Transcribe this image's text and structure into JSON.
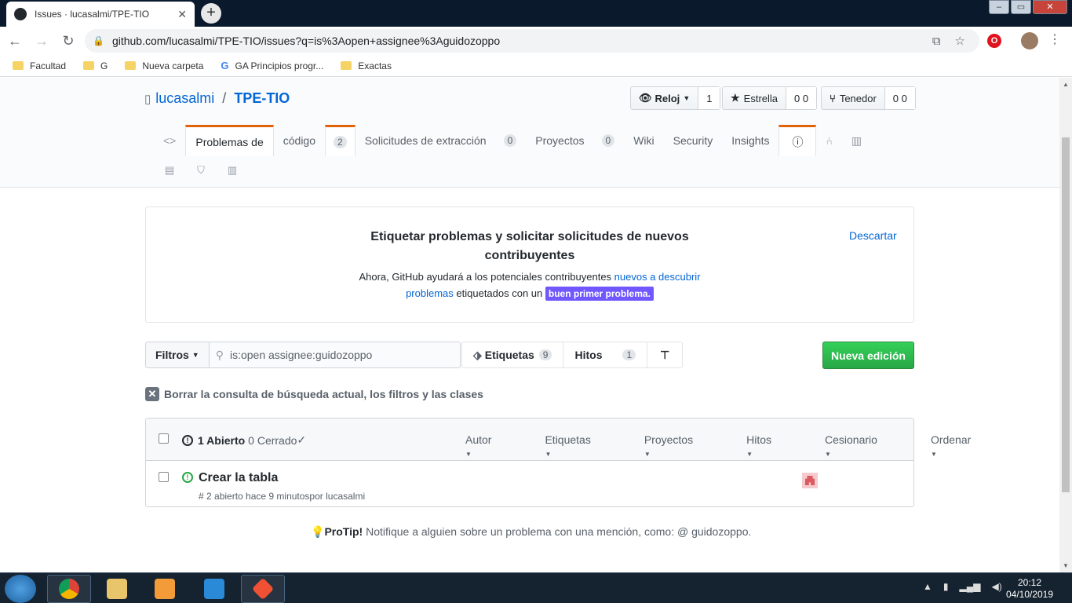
{
  "browser": {
    "tab_title": "Issues · lucasalmi/TPE-TIO",
    "tab_close": "✕",
    "new_tab": "+",
    "url": "github.com/lucasalmi/TPE-TIO/issues?q=is%3Aopen+assignee%3Aguidozoppo",
    "bookmarks": [
      {
        "label": "Facultad",
        "icon": "folder-icon"
      },
      {
        "label": "G",
        "icon": "folder-icon"
      },
      {
        "label": "Nueva carpeta",
        "icon": "folder-icon"
      },
      {
        "label": "GA Principios progr...",
        "icon": "google-icon"
      },
      {
        "label": "Exactas",
        "icon": "folder-icon"
      }
    ]
  },
  "repo": {
    "owner": "lucasalmi",
    "separator": "/",
    "name": "TPE-TIO",
    "watch_label": "Reloj",
    "watch_count": "1",
    "star_label": "Estrella",
    "star_count": "0 0",
    "fork_label": "Tenedor",
    "fork_count": "0 0"
  },
  "reponav": {
    "issues_label": "Problemas de",
    "code_label": "código",
    "issues_count": "2",
    "pulls_label": "Solicitudes de extracción",
    "pulls_count": "0",
    "projects_label": "Proyectos",
    "projects_count": "0",
    "wiki_label": "Wiki",
    "security_label": "Security",
    "insights_label": "Insights"
  },
  "promo": {
    "heading": "Etiquetar problemas y solicitar solicitudes de nuevos contribuyentes",
    "body_pre": "Ahora, GitHub ayudará a los potenciales contribuyentes ",
    "body_link": "nuevos a descubrir problemas",
    "body_mid": " etiquetados con un ",
    "label": "buen primer problema.",
    "dismiss": "Descartar"
  },
  "subnav": {
    "filters_label": "Filtros",
    "search_value": "is:open assignee:guidozoppo",
    "labels_label": "Etiquetas",
    "labels_count": "9",
    "milestones_label": "Hitos",
    "milestones_count": "1",
    "new_issue_label": "Nueva edición"
  },
  "clear_query": "Borrar la consulta de búsqueda actual, los filtros y las clases",
  "issues_header": {
    "open_label": "1 Abierto",
    "closed_label": "0 Cerrado",
    "filters": [
      "Autor",
      "Etiquetas",
      "Proyectos",
      "Hitos",
      "Cesionario",
      "Ordenar"
    ]
  },
  "issues": [
    {
      "title": "Crear la tabla",
      "meta": "# 2 abierto hace 9 minutospor lucasalmi"
    }
  ],
  "protip": {
    "lead": "ProTip!",
    "text": " Notifique a alguien sobre un problema con una mención, como: @ guidozoppo."
  },
  "taskbar": {
    "time": "20:12",
    "date": "04/10/2019"
  },
  "colors": {
    "link": "#0366d6",
    "new_issue_green": "#28a745",
    "good_first_issue": "#7057ff",
    "selected_tab_accent": "#e36209"
  }
}
